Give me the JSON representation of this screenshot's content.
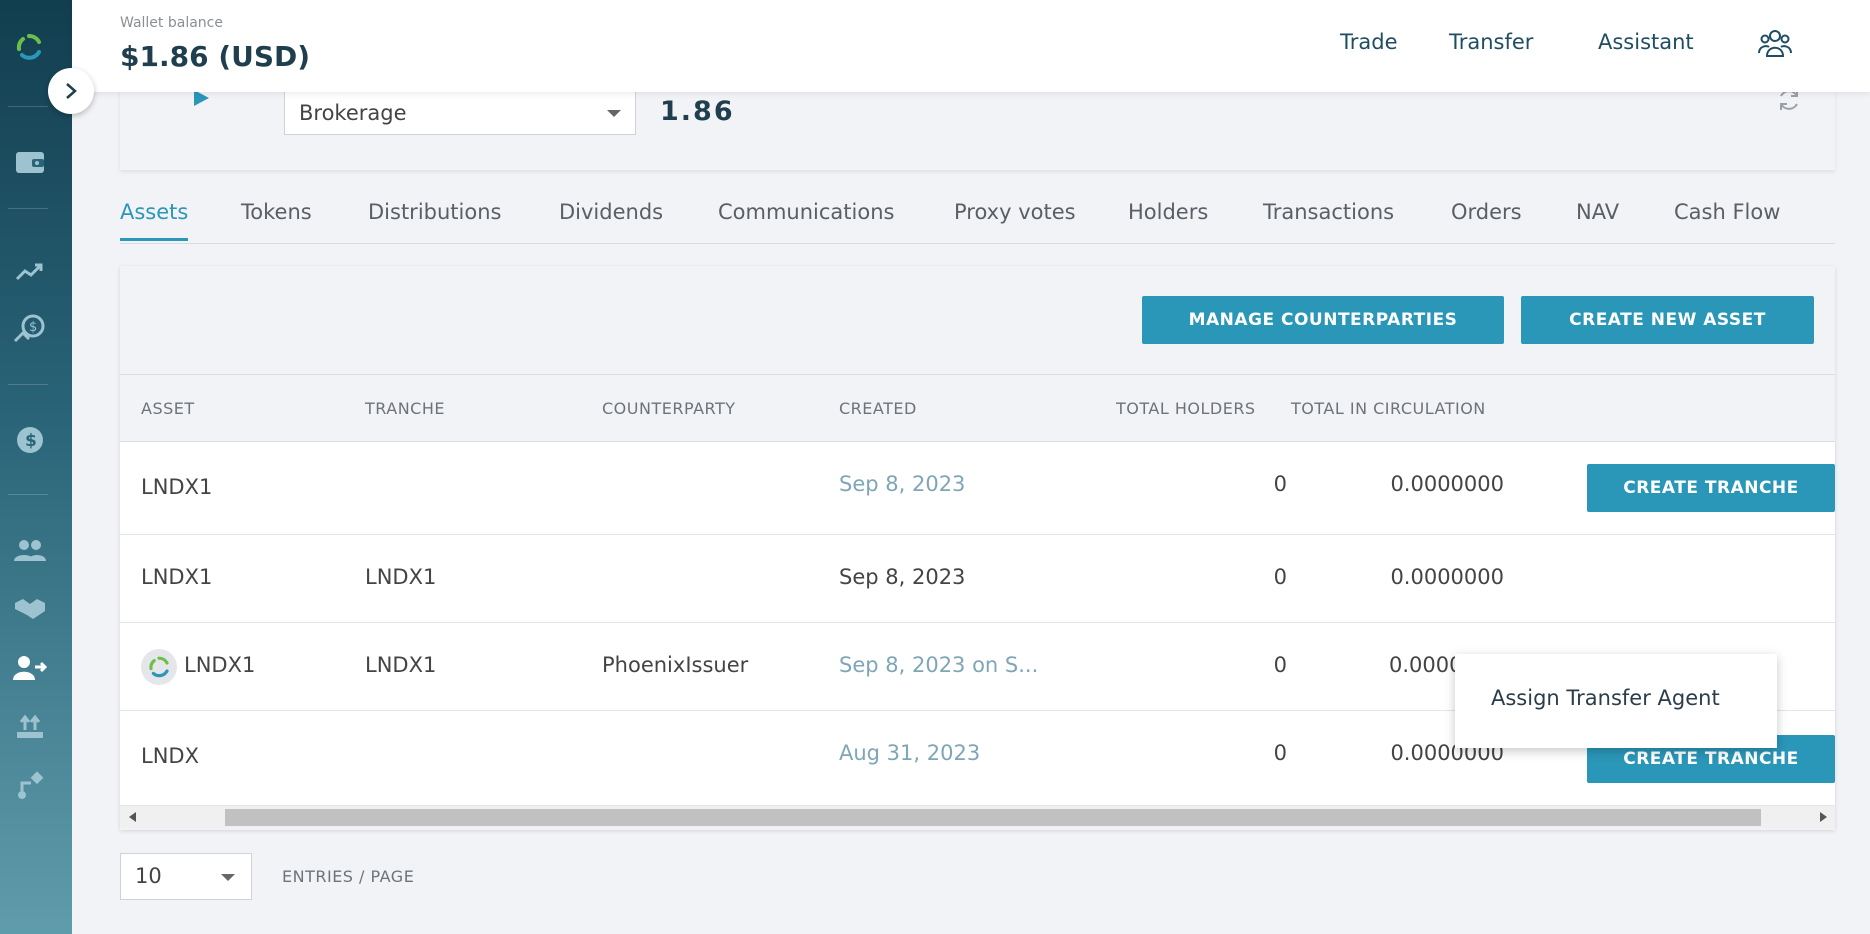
{
  "header": {
    "wallet_label": "Wallet balance",
    "wallet_value": "$1.86 (USD)",
    "nav": [
      "Trade",
      "Transfer",
      "Assistant"
    ]
  },
  "account": {
    "selected": "Brokerage",
    "amount": "1.86"
  },
  "tabs": [
    "Assets",
    "Tokens",
    "Distributions",
    "Dividends",
    "Communications",
    "Proxy votes",
    "Holders",
    "Transactions",
    "Orders",
    "NAV",
    "Cash Flow"
  ],
  "actions": {
    "manage_counterparties": "MANAGE COUNTERPARTIES",
    "create_new_asset": "CREATE NEW ASSET"
  },
  "table": {
    "columns": [
      "ASSET",
      "TRANCHE",
      "COUNTERPARTY",
      "CREATED",
      "TOTAL HOLDERS",
      "TOTAL IN CIRCULATION"
    ],
    "rows": [
      {
        "asset": "LNDX1",
        "tranche": "",
        "counterparty": "",
        "created": "Sep 8, 2023",
        "holders": "0",
        "circulation": "0.0000000",
        "action": "CREATE TRANCHE"
      },
      {
        "asset": "LNDX1",
        "tranche": "LNDX1",
        "counterparty": "",
        "created": "Sep 8, 2023",
        "holders": "0",
        "circulation": "0.0000000",
        "action": ""
      },
      {
        "asset": "LNDX1",
        "tranche": "LNDX1",
        "counterparty": "PhoenixIssuer",
        "created": "Sep 8, 2023 on S...",
        "holders": "0",
        "circulation": "0.0000",
        "action": ""
      },
      {
        "asset": "LNDX",
        "tranche": "",
        "counterparty": "",
        "created": "Aug 31, 2023",
        "holders": "0",
        "circulation": "0.0000000",
        "action": "CREATE TRANCHE"
      }
    ]
  },
  "popup": {
    "item": "Assign Transfer Agent"
  },
  "pagination": {
    "per_page": "10",
    "label": "ENTRIES / PAGE"
  },
  "colors": {
    "accent": "#2a96b8",
    "sidebar_top": "#123e4f",
    "link": "#7fa6b6"
  },
  "icons": {
    "sidebar": [
      "logo-icon",
      "wallet-icon",
      "trending-icon",
      "money-hand-icon",
      "dollar-icon",
      "users-icon",
      "handshake-icon",
      "user-transfer-icon",
      "upload-icon",
      "workflow-icon"
    ],
    "header": "team-icon"
  }
}
